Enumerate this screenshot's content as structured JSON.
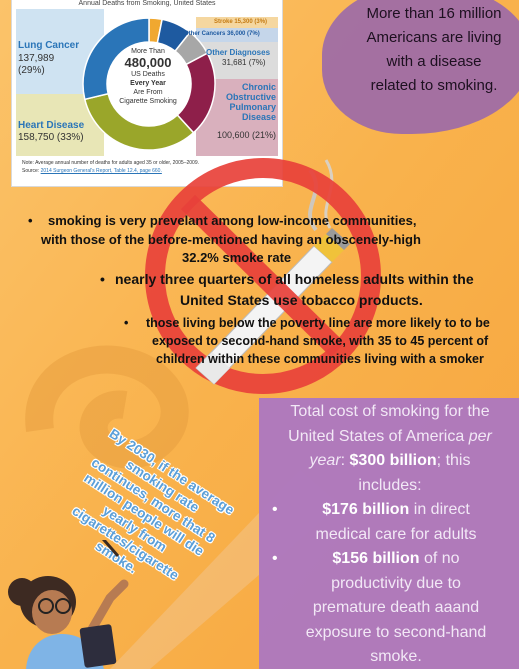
{
  "chart_card": {
    "title": "Annual Deaths from Smoking, United States",
    "center_line1": "More Than",
    "center_value": "480,000",
    "center_line2": "US Deaths",
    "center_line3": "Every Year",
    "center_line4": "Are From",
    "center_line5": "Cigarette Smoking",
    "note": "Note: Average annual number of deaths for adults aged 35 or older, 2005–2009.",
    "source_prefix": "Source: ",
    "source_link": "2014 Surgeon General's Report, Table 12.4, page 660."
  },
  "chart_data": {
    "type": "pie",
    "title": "Annual Deaths from Smoking, United States",
    "center_total": "480,000",
    "slices": [
      {
        "label": "Lung Cancer",
        "value": 137989,
        "percent_text": "(29%)",
        "value_text": "137,989",
        "color": "#2a75b8"
      },
      {
        "label": "Heart Disease",
        "value": 158750,
        "percent_text": "(33%)",
        "value_text": "158,750",
        "color": "#9aa62a"
      },
      {
        "label": "Chronic Obstructive Pulmonary Disease",
        "value": 100600,
        "percent_text": "(21%)",
        "value_text": "100,600",
        "color": "#8e1f4a"
      },
      {
        "label": "Other Diagnoses",
        "value": 31681,
        "percent_text": "(7%)",
        "value_text": "31,681",
        "color": "#a7a7a7"
      },
      {
        "label": "Other Cancers",
        "value": 36000,
        "percent_text": "(7%)",
        "value_text": "36,000",
        "color": "#1e5aa0"
      },
      {
        "label": "Stroke",
        "value": 15300,
        "percent_text": "(3%)",
        "value_text": "15,300",
        "color": "#f0a830"
      }
    ]
  },
  "chart_labels": {
    "lung_label": "Lung Cancer",
    "lung_value": "137,989",
    "lung_pct": "(29%)",
    "heart_label": "Heart Disease",
    "heart_value": "158,750 (33%)",
    "copd_line1": "Chronic",
    "copd_line2": "Obstructive",
    "copd_line3": "Pulmonary",
    "copd_line4": "Disease",
    "copd_value": "100,600 (21%)",
    "other_diag_label": "Other Diagnoses",
    "other_diag_value": "31,681 (7%)",
    "other_cancers": "Other Cancers 36,000 (7%)",
    "stroke": "Stroke 15,300 (3%)"
  },
  "blob": {
    "text_line1": "More than 16 million",
    "text_line2": "Americans are living",
    "text_line3": "with a disease",
    "text_line4": "related to smoking."
  },
  "bullets": {
    "b1_line1": "smoking is very prevelant among low-income communities,",
    "b1_line2": "with those of the before-mentioned having an obscenely-high",
    "b1_line3": "32.2% smoke rate",
    "b2_line1": "nearly three quarters of all homeless  adults within the",
    "b2_line2": "United States use tobacco products.",
    "b3_line1": "those  living below the poverty line are more likely to to be",
    "b3_line2": "exposed to second-hand smoke, with 35 to 45 percent of",
    "b3_line3": "children within these communities living with a smoker"
  },
  "rotated": {
    "line1": "By 2030, if the average",
    "line2": "smoking rate",
    "line3": "continues, more that 8",
    "line4": "million people will die",
    "line5": "yearly from",
    "line6": "cigarettes/cigarette",
    "line7": "smoke."
  },
  "cost": {
    "intro_1": "Total cost of  smoking for the",
    "intro_2": "United States of America ",
    "intro_2_italic": "per",
    "intro_3_italic": "year",
    "intro_3_rest": ": ",
    "intro_3_bold": "$300 billion",
    "intro_3_tail": "; this",
    "intro_4": "includes:",
    "item1_bold": "$176 billion",
    "item1_rest": " in direct",
    "item1_line2": "medical care for adults",
    "item2_bold": "$156 billion",
    "item2_rest": " of no",
    "item2_line2": "productivity due to",
    "item2_line3": "premature death aaand",
    "item2_line4": "exposure to second-hand",
    "item2_line5": "smoke."
  },
  "icons": [
    "no-smoking-icon",
    "cigarette-icon",
    "teacher-illustration"
  ],
  "colors": {
    "background": "#f9b24c",
    "purple": "#ad78c0",
    "blob_purple": "#9c6aa8",
    "no_sign_red": "#e8413a",
    "rotated_text": "#5b9fd8"
  }
}
